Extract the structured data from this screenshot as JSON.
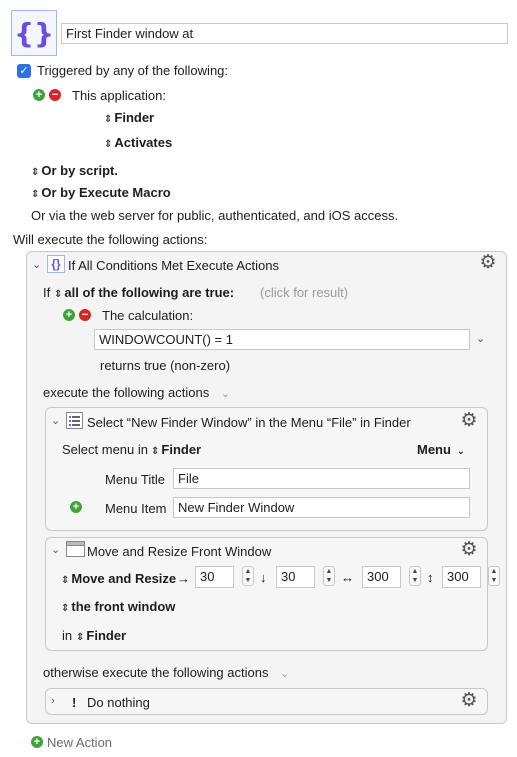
{
  "macro": {
    "name_value": "First Finder window at",
    "triggered_label": "Triggered by any of the following:",
    "trigger_app_label": "This application:",
    "trigger_app_name": "Finder",
    "trigger_app_event": "Activates",
    "or_by_script": "Or by script.",
    "or_by_execute_macro": "Or by Execute Macro",
    "web_server_text": "Or via the web server for public, authenticated, and iOS access.",
    "will_execute": "Will execute the following actions:"
  },
  "if_action": {
    "title": "If All Conditions Met Execute Actions",
    "if_prefix": "If",
    "condition_mode": "all of the following are true:",
    "click_for_result": "(click for result)",
    "calculation_label": "The calculation:",
    "calculation_value": "WINDOWCOUNT() = 1",
    "returns_text": "returns true (non-zero)",
    "execute_label": "execute the following actions",
    "otherwise_label": "otherwise execute the following actions"
  },
  "select_menu_action": {
    "title": "Select “New Finder Window” in the Menu “File” in Finder",
    "select_menu_in": "Select menu in",
    "app_name": "Finder",
    "menu_dropdown": "Menu",
    "menu_title_label": "Menu Title",
    "menu_title_value": "File",
    "menu_item_label": "Menu Item",
    "menu_item_value": "New Finder Window"
  },
  "move_resize_action": {
    "title": "Move and Resize Front Window",
    "mode": "Move and Resize",
    "x": "30",
    "y": "30",
    "width": "300",
    "height": "300",
    "target_window": "the front window",
    "in_prefix": "in",
    "app_name": "Finder"
  },
  "do_nothing_action": {
    "title": "Do nothing"
  },
  "new_action_label": "New Action",
  "colors": {
    "accent_blue": "#2f6fe4",
    "plus_green": "#3fa33a",
    "minus_red": "#d9252a",
    "icon_purple": "#6b4fdc"
  }
}
